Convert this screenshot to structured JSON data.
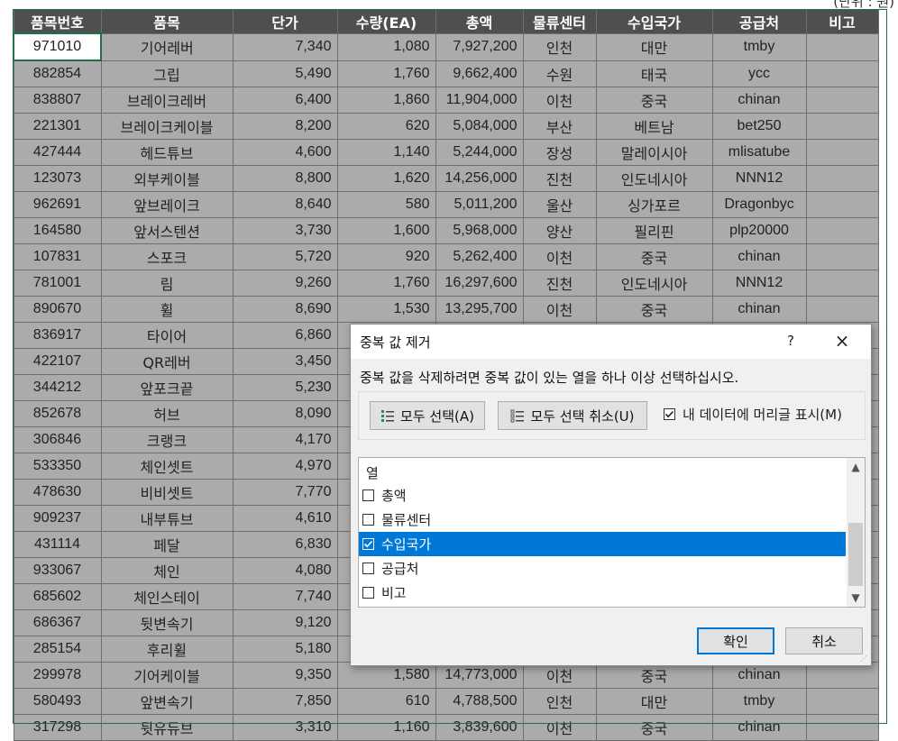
{
  "unit_note": "(단위 : 원)",
  "columns": [
    "품목번호",
    "품목",
    "단가",
    "수량(EA)",
    "총액",
    "물류센터",
    "수입국가",
    "공급처",
    "비고"
  ],
  "rows": [
    [
      "971010",
      "기어레버",
      "7,340",
      "1,080",
      "7,927,200",
      "인천",
      "대만",
      "tmby",
      ""
    ],
    [
      "882854",
      "그립",
      "5,490",
      "1,760",
      "9,662,400",
      "수원",
      "태국",
      "ycc",
      ""
    ],
    [
      "838807",
      "브레이크레버",
      "6,400",
      "1,860",
      "11,904,000",
      "이천",
      "중국",
      "chinan",
      ""
    ],
    [
      "221301",
      "브레이크케이블",
      "8,200",
      "620",
      "5,084,000",
      "부산",
      "베트남",
      "bet250",
      ""
    ],
    [
      "427444",
      "헤드튜브",
      "4,600",
      "1,140",
      "5,244,000",
      "장성",
      "말레이시아",
      "mlisatube",
      ""
    ],
    [
      "123073",
      "외부케이블",
      "8,800",
      "1,620",
      "14,256,000",
      "진천",
      "인도네시아",
      "NNN12",
      ""
    ],
    [
      "962691",
      "앞브레이크",
      "8,640",
      "580",
      "5,011,200",
      "울산",
      "싱가포르",
      "Dragonbyc",
      ""
    ],
    [
      "164580",
      "앞서스텐션",
      "3,730",
      "1,600",
      "5,968,000",
      "양산",
      "필리핀",
      "plp20000",
      ""
    ],
    [
      "107831",
      "스포크",
      "5,720",
      "920",
      "5,262,400",
      "이천",
      "중국",
      "chinan",
      ""
    ],
    [
      "781001",
      "림",
      "9,260",
      "1,760",
      "16,297,600",
      "진천",
      "인도네시아",
      "NNN12",
      ""
    ],
    [
      "890670",
      "휠",
      "8,690",
      "1,530",
      "13,295,700",
      "이천",
      "중국",
      "chinan",
      ""
    ],
    [
      "836917",
      "타이어",
      "6,860",
      "",
      "",
      "",
      "",
      "",
      ""
    ],
    [
      "422107",
      "QR레버",
      "3,450",
      "",
      "",
      "",
      "",
      "",
      ""
    ],
    [
      "344212",
      "앞포크끝",
      "5,230",
      "",
      "",
      "",
      "",
      "",
      ""
    ],
    [
      "852678",
      "허브",
      "8,090",
      "",
      "",
      "",
      "",
      "",
      ""
    ],
    [
      "306846",
      "크랭크",
      "4,170",
      "",
      "",
      "",
      "",
      "",
      ""
    ],
    [
      "533350",
      "체인셋트",
      "4,970",
      "",
      "",
      "",
      "",
      "",
      ""
    ],
    [
      "478630",
      "비비셋트",
      "7,770",
      "",
      "",
      "",
      "",
      "",
      ""
    ],
    [
      "909237",
      "내부튜브",
      "4,610",
      "",
      "",
      "",
      "",
      "",
      ""
    ],
    [
      "431114",
      "페달",
      "6,830",
      "",
      "",
      "",
      "",
      "",
      ""
    ],
    [
      "933067",
      "체인",
      "4,080",
      "",
      "",
      "",
      "",
      "",
      ""
    ],
    [
      "685602",
      "체인스테이",
      "7,740",
      "",
      "",
      "",
      "",
      "",
      ""
    ],
    [
      "686367",
      "뒷변속기",
      "9,120",
      "",
      "",
      "",
      "",
      "",
      ""
    ],
    [
      "285154",
      "후리휠",
      "5,180",
      "",
      "",
      "",
      "",
      "",
      ""
    ],
    [
      "299978",
      "기어케이블",
      "9,350",
      "1,580",
      "14,773,000",
      "이천",
      "중국",
      "chinan",
      ""
    ],
    [
      "580493",
      "앞변속기",
      "7,850",
      "610",
      "4,788,500",
      "인천",
      "대만",
      "tmby",
      ""
    ],
    [
      "317298",
      "뒷유듀브",
      "3,310",
      "1,160",
      "3,839,600",
      "이천",
      "중국",
      "chinan",
      ""
    ]
  ],
  "dialog": {
    "title": "중복 값 제거",
    "help_label": "?",
    "close_label": "×",
    "instruction": "중복 값을 삭제하려면 중복 값이 있는 열을 하나 이상 선택하십시오.",
    "select_all_label": "모두 선택(A)",
    "unselect_all_label": "모두 선택 취소(U)",
    "header_checkbox_label": "내 데이터에 머리글 표시(M)",
    "header_checkbox_checked": true,
    "list_header": "열",
    "column_options": [
      {
        "label": "총액",
        "checked": false,
        "selected": false
      },
      {
        "label": "물류센터",
        "checked": false,
        "selected": false
      },
      {
        "label": "수입국가",
        "checked": true,
        "selected": true
      },
      {
        "label": "공급처",
        "checked": false,
        "selected": false
      },
      {
        "label": "비고",
        "checked": false,
        "selected": false
      }
    ],
    "ok_label": "확인",
    "cancel_label": "취소"
  }
}
